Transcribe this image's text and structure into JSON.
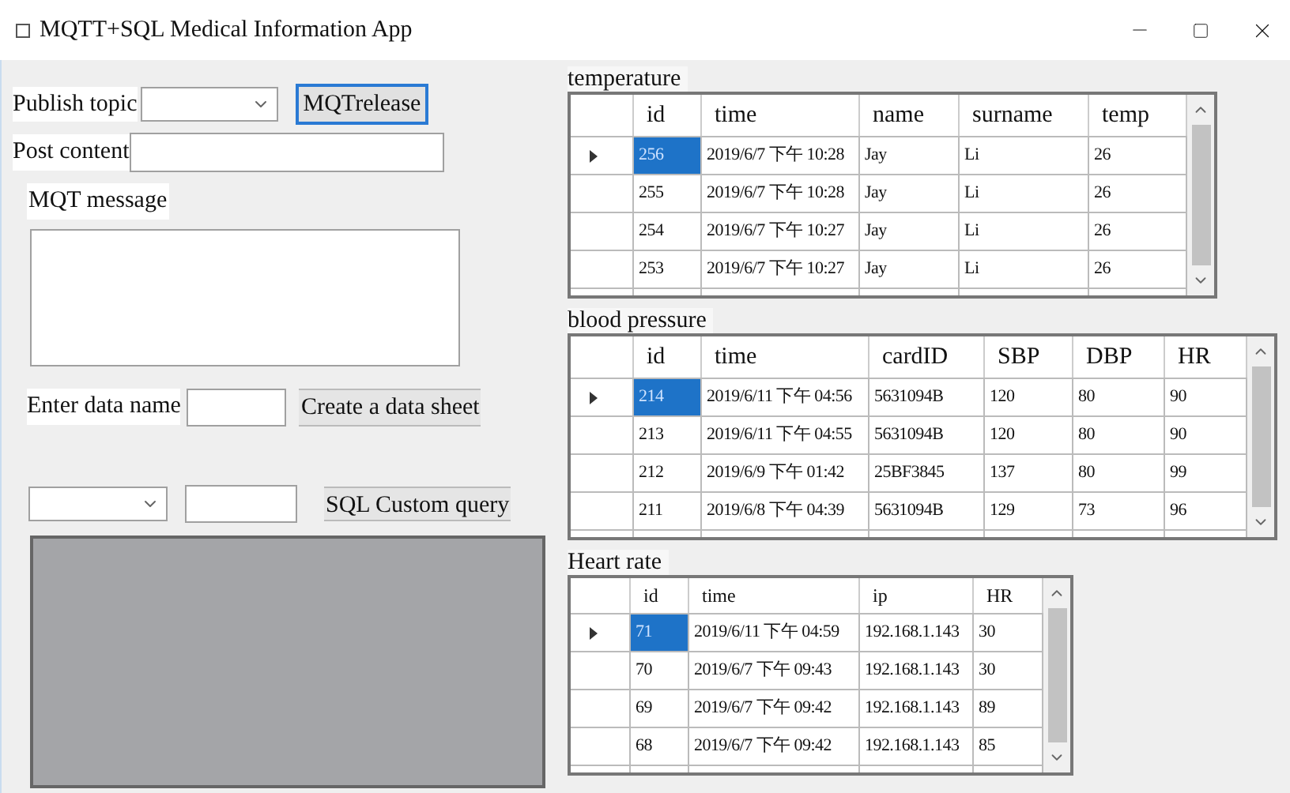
{
  "window": {
    "title": "MQTT+SQL Medical Information App"
  },
  "publish": {
    "topic_label": "Publish topic",
    "release_button": {
      "label": "MQTrelease",
      "focused": true
    },
    "content_label": "Post content",
    "message_label": "MQT message"
  },
  "create": {
    "label": "Enter data name",
    "button": "Create a data sheet"
  },
  "query": {
    "button": "SQL Custom query"
  },
  "tables": [
    {
      "title": "temperature",
      "columns": [
        "id",
        "time",
        "name",
        "surname",
        "temp"
      ],
      "rows": [
        {
          "selected": true,
          "cells": [
            "256",
            "2019/6/7 下午 10:28",
            "Jay",
            "Li",
            "26"
          ]
        },
        {
          "selected": false,
          "cells": [
            "255",
            "2019/6/7 下午 10:28",
            "Jay",
            "Li",
            "26"
          ]
        },
        {
          "selected": false,
          "cells": [
            "254",
            "2019/6/7 下午 10:27",
            "Jay",
            "Li",
            "26"
          ]
        },
        {
          "selected": false,
          "cells": [
            "253",
            "2019/6/7 下午 10:27",
            "Jay",
            "Li",
            "26"
          ]
        }
      ]
    },
    {
      "title": "blood pressure",
      "columns": [
        "id",
        "time",
        "cardID",
        "SBP",
        "DBP",
        "HR"
      ],
      "rows": [
        {
          "selected": true,
          "cells": [
            "214",
            "2019/6/11 下午 04:56",
            "5631094B",
            "120",
            "80",
            "90"
          ]
        },
        {
          "selected": false,
          "cells": [
            "213",
            "2019/6/11 下午 04:55",
            "5631094B",
            "120",
            "80",
            "90"
          ]
        },
        {
          "selected": false,
          "cells": [
            "212",
            "2019/6/9 下午 01:42",
            "25BF3845",
            "137",
            "80",
            "99"
          ]
        },
        {
          "selected": false,
          "cells": [
            "211",
            "2019/6/8 下午 04:39",
            "5631094B",
            "129",
            "73",
            "96"
          ]
        }
      ]
    },
    {
      "title": "Heart rate",
      "columns": [
        "id",
        "time",
        "ip",
        "HR"
      ],
      "rows": [
        {
          "selected": true,
          "cells": [
            "71",
            "2019/6/11 下午 04:59",
            "192.168.1.143",
            "30"
          ]
        },
        {
          "selected": false,
          "cells": [
            "70",
            "2019/6/7 下午 09:43",
            "192.168.1.143",
            "30"
          ]
        },
        {
          "selected": false,
          "cells": [
            "69",
            "2019/6/7 下午 09:42",
            "192.168.1.143",
            "89"
          ]
        },
        {
          "selected": false,
          "cells": [
            "68",
            "2019/6/7 下午 09:42",
            "192.168.1.143",
            "85"
          ]
        }
      ]
    }
  ]
}
